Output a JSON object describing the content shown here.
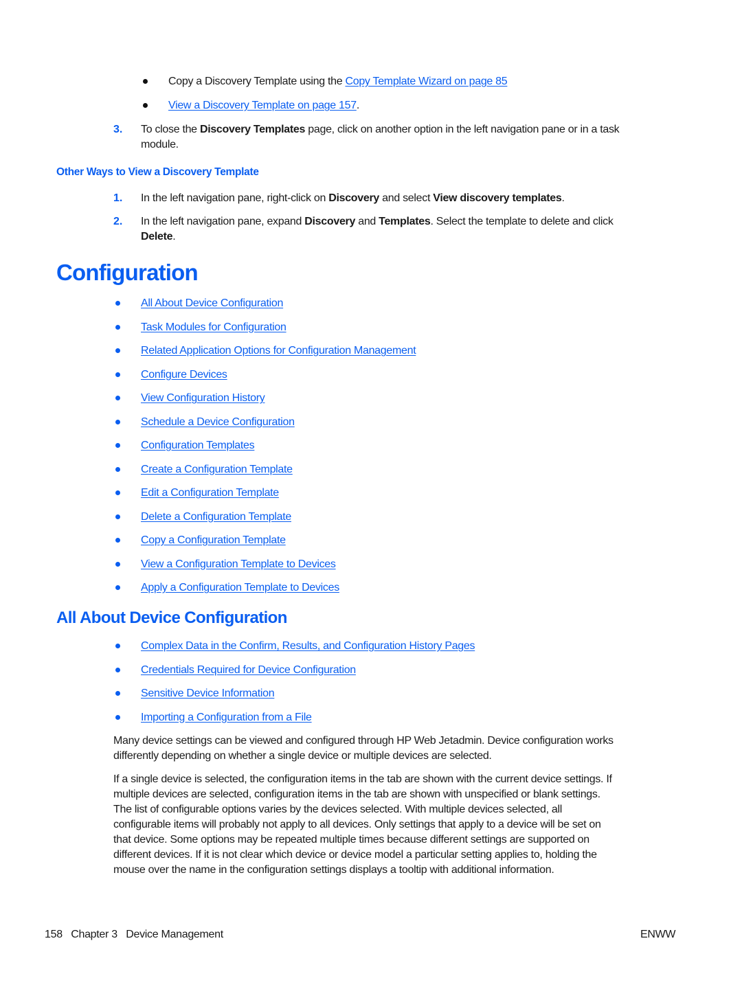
{
  "top_bullets": [
    {
      "prefix": "Copy a Discovery Template using the ",
      "link": "Copy Template Wizard on page 85",
      "suffix": ""
    },
    {
      "prefix": "",
      "link": "View a Discovery Template on page 157",
      "suffix": "."
    }
  ],
  "step3": {
    "number": "3.",
    "text_before": "To close the ",
    "bold": "Discovery Templates",
    "text_after_line1": " page, click on another option in the left navigation pane or in a task",
    "text_line2": "module."
  },
  "other_ways": {
    "heading": "Other Ways to View a Discovery Template",
    "steps": [
      {
        "number": "1.",
        "t1": "In the left navigation pane, right-click on ",
        "b1": "Discovery",
        "t2": " and select ",
        "b2": "View discovery templates",
        "t3": "."
      },
      {
        "number": "2.",
        "t1": "In the left navigation pane, expand ",
        "b1": "Discovery",
        "t2": " and ",
        "b2": "Templates",
        "t3": ". Select the template to delete and click",
        "b3": "Delete",
        "t4": "."
      }
    ]
  },
  "configuration": {
    "heading": "Configuration",
    "links": [
      "All About Device Configuration",
      "Task Modules for Configuration",
      "Related Application Options for Configuration Management",
      "Configure Devices",
      "View Configuration History",
      "Schedule a Device Configuration",
      "Configuration Templates",
      "Create a Configuration Template",
      "Edit a Configuration Template",
      "Delete a Configuration Template",
      "Copy a Configuration Template",
      "View a Configuration Template to Devices",
      "Apply a Configuration Template to Devices"
    ]
  },
  "all_about": {
    "heading": "All About Device Configuration",
    "links": [
      "Complex Data in the Confirm, Results, and Configuration History Pages",
      "Credentials Required for Device Configuration",
      "Sensitive Device Information",
      "Importing a Configuration from a File"
    ],
    "para1": [
      "Many device settings can be viewed and configured through HP Web Jetadmin. Device configuration works",
      "differently depending on whether a single device or multiple devices are selected."
    ],
    "para2": [
      "If a single device is selected, the configuration items in the tab are shown with the current device settings. If",
      "multiple devices are selected, configuration items in the tab are shown with unspecified or blank settings.",
      "The list of configurable options varies by the devices selected. With multiple devices selected, all",
      "configurable items will probably not apply to all devices. Only settings that apply to a device will be set on",
      "that device. Some options may be repeated multiple times because different settings are supported on",
      "different devices. If it is not clear which device or device model a particular setting applies to, holding the",
      "mouse over the name in the configuration settings displays a tooltip with additional information."
    ]
  },
  "footer": {
    "page_number": "158",
    "chapter": "Chapter 3",
    "chapter_title": "Device Management",
    "locale": "ENWW"
  },
  "colors": {
    "accent": "#0a5ef0",
    "text": "#1a1a1a"
  }
}
